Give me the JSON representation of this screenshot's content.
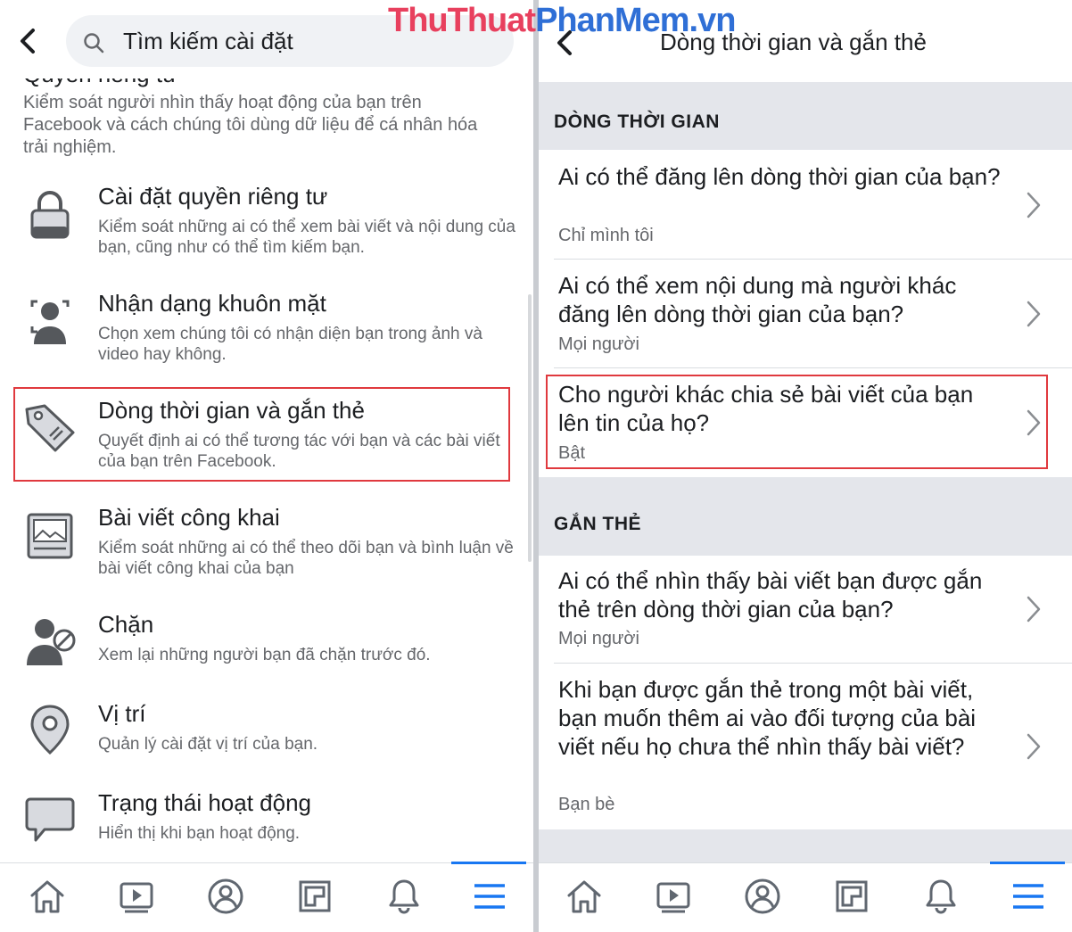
{
  "watermark": {
    "part1": "ThuThuat",
    "part2": "PhanMem.vn"
  },
  "left": {
    "search_placeholder": "Tìm kiếm cài đặt",
    "clipped_heading": "Quyền riêng tư",
    "intro": "Kiểm soát người nhìn thấy hoạt động của bạn trên Facebook và cách chúng tôi dùng dữ liệu để cá nhân hóa trải nghiệm.",
    "items": [
      {
        "icon": "lock-icon",
        "title": "Cài đặt quyền riêng tư",
        "desc": "Kiểm soát những ai có thể xem bài viết và nội dung của bạn, cũng như có thể tìm kiếm bạn."
      },
      {
        "icon": "face-recognition-icon",
        "title": "Nhận dạng khuôn mặt",
        "desc": "Chọn xem chúng tôi có nhận diện bạn trong ảnh và video hay không."
      },
      {
        "icon": "tag-icon",
        "title": "Dòng thời gian và gắn thẻ",
        "desc": "Quyết định ai có thể tương tác với bạn và các bài viết của bạn trên Facebook."
      },
      {
        "icon": "public-post-icon",
        "title": "Bài viết công khai",
        "desc": "Kiểm soát những ai có thể theo dõi bạn và bình luận về bài viết công khai của bạn"
      },
      {
        "icon": "block-user-icon",
        "title": "Chặn",
        "desc": "Xem lại những người bạn đã chặn trước đó."
      },
      {
        "icon": "location-pin-icon",
        "title": "Vị trí",
        "desc": "Quản lý cài đặt vị trí của bạn."
      },
      {
        "icon": "chat-bubble-icon",
        "title": "Trạng thái hoạt động",
        "desc": "Hiển thị khi bạn hoạt động."
      }
    ]
  },
  "right": {
    "title": "Dòng thời gian và gắn thẻ",
    "sections": [
      {
        "label": "DÒNG THỜI GIAN",
        "rows": [
          {
            "question": "Ai có thể đăng lên dòng thời gian của bạn?",
            "value": "Chỉ mình tôi"
          },
          {
            "question": "Ai có thể xem nội dung mà người khác đăng lên dòng thời gian của bạn?",
            "value": "Mọi người"
          },
          {
            "question": "Cho người khác chia sẻ bài viết của bạn lên tin của họ?",
            "value": "Bật"
          }
        ]
      },
      {
        "label": "GẮN THẺ",
        "rows": [
          {
            "question": "Ai có thể nhìn thấy bài viết bạn được gắn thẻ trên dòng thời gian của bạn?",
            "value": "Mọi người"
          },
          {
            "question": "Khi bạn được gắn thẻ trong một bài viết, bạn muốn thêm ai vào đối tượng của bài viết nếu họ chưa thể nhìn thấy bài viết?",
            "value": "Bạn bè"
          }
        ]
      }
    ]
  },
  "tabbar": [
    "home-icon",
    "watch-icon",
    "profile-icon",
    "pages-icon",
    "notifications-icon",
    "menu-icon"
  ],
  "colors": {
    "highlight": "#e0393e",
    "accent": "#1877f2",
    "section_bg": "#e4e6eb"
  }
}
